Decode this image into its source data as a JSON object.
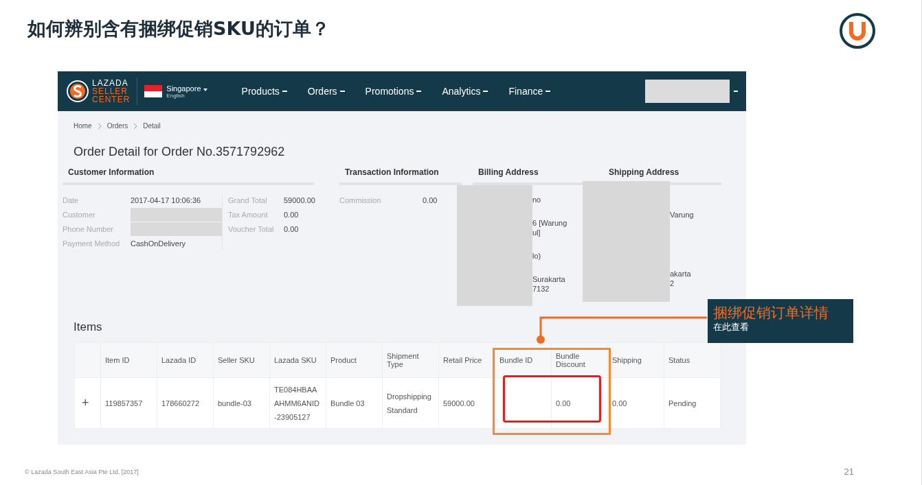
{
  "slide": {
    "title": "如何辨别含有捆绑促销SKU的订单？",
    "footer": "© Lazada South East Asia Pte Ltd, [2017]",
    "page_number": "21"
  },
  "app": {
    "logo": [
      "LAZADA",
      "SELLER",
      "CENTER"
    ],
    "country": "Singapore",
    "language": "English",
    "nav": [
      {
        "label": "Products"
      },
      {
        "label": "Orders"
      },
      {
        "label": "Promotions"
      },
      {
        "label": "Analytics"
      },
      {
        "label": "Finance"
      }
    ],
    "breadcrumb": [
      "Home",
      "Orders",
      "Detail"
    ],
    "page_title": "Order Detail for Order No.3571792962",
    "sections": [
      "Customer Information",
      "Transaction Information",
      "Billing Address",
      "Shipping Address"
    ],
    "customer_fields": [
      {
        "label": "Date",
        "value": "2017-04-17 10:06:36"
      },
      {
        "label": "Customer",
        "redacted": true
      },
      {
        "label": "Phone Number",
        "redacted": true
      },
      {
        "label": "Payment Method",
        "value": "CashOnDelivery"
      }
    ],
    "totals": [
      {
        "label": "Grand Total",
        "value": "59000.00"
      },
      {
        "label": "Tax Amount",
        "value": "0.00"
      },
      {
        "label": "Voucher Total",
        "value": "0.00"
      }
    ],
    "transaction": [
      {
        "label": "Commission",
        "value": "0.00"
      }
    ],
    "billing_lines": [
      [
        "no"
      ],
      [
        "6 [Warung",
        "ul]"
      ],
      [
        "lo)"
      ],
      [
        "Surakarta",
        "7132"
      ]
    ],
    "shipping_lines": [
      [
        "Varung"
      ],
      [
        "akarta",
        "2"
      ]
    ],
    "items_title": "Items",
    "table": {
      "columns": [
        "Item ID",
        "Lazada ID",
        "Seller SKU",
        "Lazada SKU",
        "Product",
        "Shipment Type",
        "Retail Price",
        "Bundle ID",
        "Bundle Discount",
        "Shipping",
        "Status"
      ],
      "rows": [
        {
          "expand": "+",
          "cells": [
            "119857357",
            "178660272",
            "bundle-03",
            "TE084HBAA AHMM6ANID -23905127",
            "Bundle 03",
            "Dropshipping Standard",
            "59000.00",
            "",
            "0.00",
            "0.00",
            "Pending"
          ]
        }
      ]
    }
  },
  "callout": {
    "title": "捆绑促销订单详情",
    "subtitle": "在此查看"
  }
}
